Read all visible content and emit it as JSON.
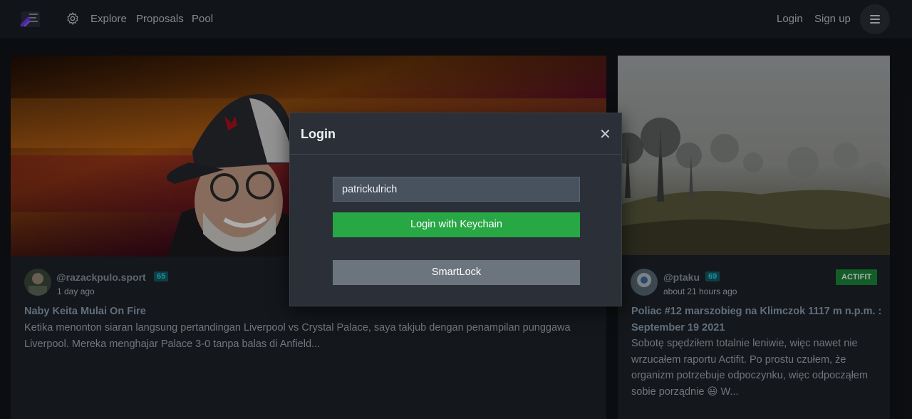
{
  "nav": {
    "logo_icon": "peakd-logo-icon",
    "settings_icon": "gear-icon",
    "links": [
      "Explore",
      "Proposals",
      "Pool"
    ],
    "login": "Login",
    "signup": "Sign up",
    "menu_icon": "hamburger-icon"
  },
  "posts": [
    {
      "author": "@razackpulo.sport",
      "reputation": "65",
      "time": "1 day ago",
      "title": "Naby Keita Mulai On Fire",
      "excerpt_lines": [
        "Ketika menonton siaran langsung pertandingan Liverpool vs Crystal Palace, saya takjub dengan penampilan punggawa",
        "Liverpool. Mereka menghajar Palace 3-0 tanpa balas di Anfield..."
      ]
    },
    {
      "author": "@ptaku",
      "reputation": "69",
      "time": "about 21 hours ago",
      "badge": "ACTIFIT",
      "title_lines": [
        "Poliac #12 marszobieg na Klimczok 1117 m n.p.m. :",
        "September 19 2021"
      ],
      "excerpt_lines": [
        "Sobotę spędziłem totalnie leniwie, więc nawet nie",
        "wrzucałem raportu Actifit. Po prostu czułem, że",
        "organizm potrzebuje odpoczynku, więc odpocząłem",
        "sobie porządnie 😃 W..."
      ]
    }
  ],
  "modal": {
    "title": "Login",
    "close_icon": "close-icon",
    "username_value": "patrickulrich",
    "keychain_button": "Login with Keychain",
    "smartlock_button": "SmartLock"
  },
  "colors": {
    "accent_green": "#28a745",
    "secondary_gray": "#6c757d",
    "reputation_bg": "#165e68",
    "badge_green": "#1b8a3b"
  }
}
